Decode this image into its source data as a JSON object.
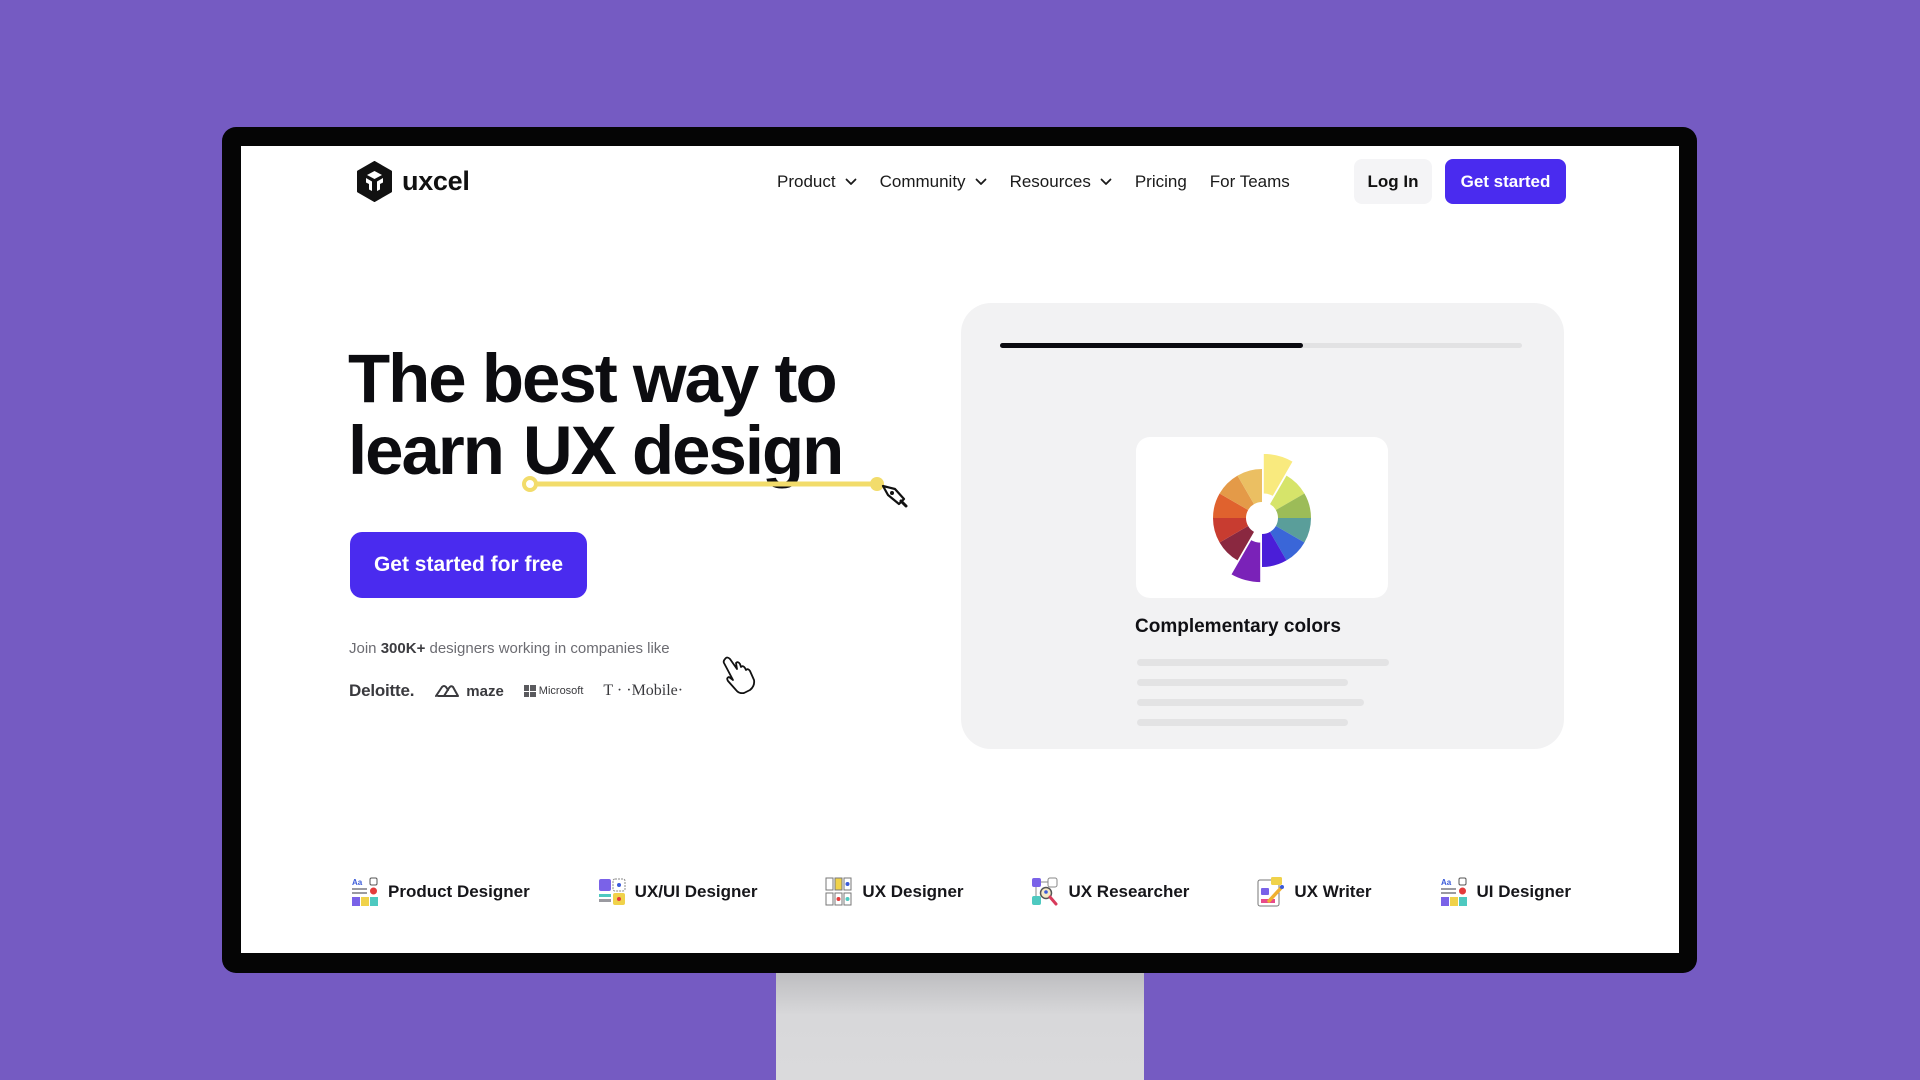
{
  "brand": {
    "name": "uxcel",
    "accent": "#4a2bef",
    "background": "#755bc2"
  },
  "nav": {
    "items": [
      {
        "label": "Product",
        "has_dropdown": true
      },
      {
        "label": "Community",
        "has_dropdown": true
      },
      {
        "label": "Resources",
        "has_dropdown": true
      },
      {
        "label": "Pricing",
        "has_dropdown": false
      },
      {
        "label": "For Teams",
        "has_dropdown": false
      }
    ],
    "login_label": "Log In",
    "get_started_label": "Get started"
  },
  "hero": {
    "title_line1": "The best way to",
    "title_line2_prefix": "learn",
    "title_highlight": "UX design",
    "cta_label": "Get started for free",
    "join_prefix": "Join",
    "join_count": "300K+",
    "join_suffix": "designers working in companies like",
    "companies": [
      "Deloitte.",
      "maze",
      "Microsoft",
      "T · ·Mobile·"
    ],
    "highlight_color": "#f2dc6b"
  },
  "lesson_card": {
    "progress_percent": 58,
    "title": "Complementary colors",
    "wheel_colors": [
      "#f9ea7e",
      "#d6e46a",
      "#9cbc58",
      "#5a9e9a",
      "#3a66d8",
      "#4a1ed8",
      "#7a22b8",
      "#8a2840",
      "#c83c30",
      "#e0622e",
      "#e49a48",
      "#ebbf62"
    ]
  },
  "roles": [
    {
      "label": "Product Designer",
      "icon": "product-designer-icon"
    },
    {
      "label": "UX/UI Designer",
      "icon": "ux-ui-designer-icon"
    },
    {
      "label": "UX Designer",
      "icon": "ux-designer-icon"
    },
    {
      "label": "UX Researcher",
      "icon": "ux-researcher-icon"
    },
    {
      "label": "UX Writer",
      "icon": "ux-writer-icon"
    },
    {
      "label": "UI Designer",
      "icon": "ui-designer-icon"
    }
  ]
}
